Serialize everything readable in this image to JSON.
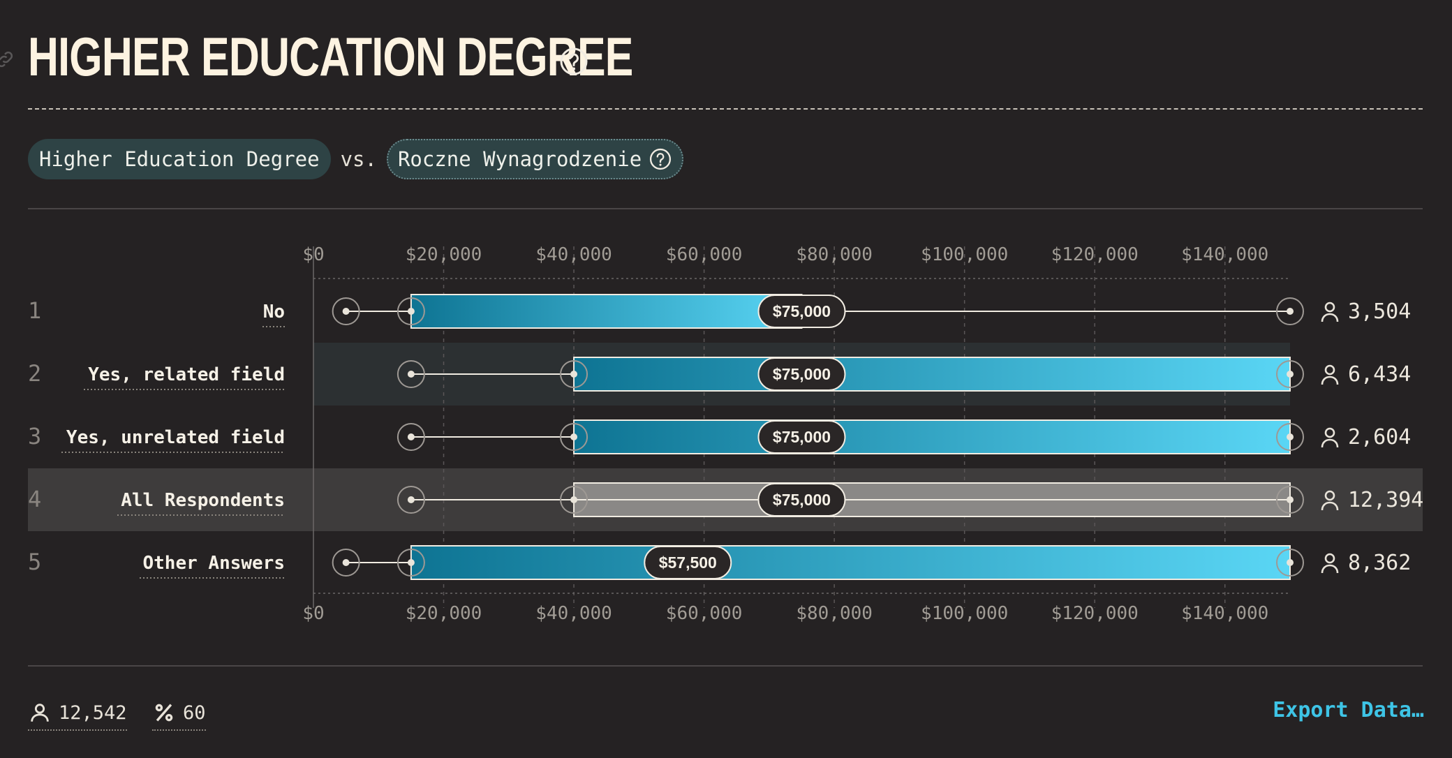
{
  "page": {
    "title": "HIGHER EDUCATION DEGREE",
    "pill_primary": "Higher Education Degree",
    "vs_label": "vs.",
    "pill_secondary": "Roczne Wynagrodzenie",
    "export_label": "Export Data…",
    "footer_respondents": "12,542",
    "footer_percent": "60"
  },
  "colors": {
    "background": "#252223",
    "bar_dark": "#0e7493",
    "bar_light": "#5ad6f5",
    "all_bar": "#8a8886",
    "accent": "#3ec4e6"
  },
  "chart_data": {
    "type": "box-range",
    "xlim": [
      0,
      150000
    ],
    "ticks": [
      0,
      20000,
      40000,
      60000,
      80000,
      100000,
      120000,
      140000
    ],
    "tick_labels": [
      "$0",
      "$20,000",
      "$40,000",
      "$60,000",
      "$80,000",
      "$100,000",
      "$120,000",
      "$140,000"
    ],
    "rows": [
      {
        "index": "1",
        "label": "No",
        "min": 5000,
        "q1": 15000,
        "median": 75000,
        "q3": 75000,
        "max": 150000,
        "median_label": "$75,000",
        "count": "3,504"
      },
      {
        "index": "2",
        "label": "Yes, related field",
        "min": 15000,
        "q1": 40000,
        "median": 75000,
        "q3": 150000,
        "max": 150000,
        "median_label": "$75,000",
        "count": "6,434"
      },
      {
        "index": "3",
        "label": "Yes, unrelated field",
        "min": 15000,
        "q1": 40000,
        "median": 75000,
        "q3": 150000,
        "max": 150000,
        "median_label": "$75,000",
        "count": "2,604"
      },
      {
        "index": "4",
        "label": "All Respondents",
        "min": 15000,
        "q1": 40000,
        "median": 75000,
        "q3": 150000,
        "max": 150000,
        "median_label": "$75,000",
        "count": "12,394",
        "highlight": true
      },
      {
        "index": "5",
        "label": "Other Answers",
        "min": 5000,
        "q1": 15000,
        "median": 57500,
        "q3": 150000,
        "max": 150000,
        "median_label": "$57,500",
        "count": "8,362"
      }
    ]
  }
}
